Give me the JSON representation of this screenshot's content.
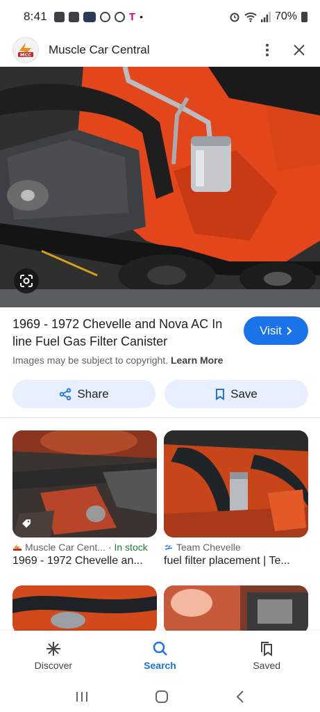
{
  "status_bar": {
    "time": "8:41",
    "carrier_glyph": "T",
    "dot": "•",
    "battery": "70%"
  },
  "header": {
    "site_name": "Muscle Car Central",
    "logo_text": "MCC"
  },
  "result": {
    "title": "1969 - 1972 Chevelle and Nova AC In line Fuel Gas Filter Canister",
    "visit_label": "Visit",
    "copyright_text": "Images may be subject to copyright.",
    "learn_more": "Learn More"
  },
  "actions": {
    "share_label": "Share",
    "save_label": "Save"
  },
  "related": [
    {
      "source": "Muscle Car Cent...",
      "stock": "· In stock",
      "title": "1969 - 1972 Chevelle an..."
    },
    {
      "source": "Team Chevelle",
      "stock": "",
      "title": "fuel filter placement | Te..."
    }
  ],
  "bottom_nav": {
    "items": [
      {
        "label": "Discover",
        "icon": "asterisk-icon"
      },
      {
        "label": "Search",
        "icon": "search-icon",
        "active": true
      },
      {
        "label": "Saved",
        "icon": "bookmarks-icon"
      }
    ]
  },
  "colors": {
    "accent": "#1a73e8",
    "pill_bg": "#e8f0fe",
    "stock_green": "#188038",
    "engine_orange": "#e2461a"
  }
}
